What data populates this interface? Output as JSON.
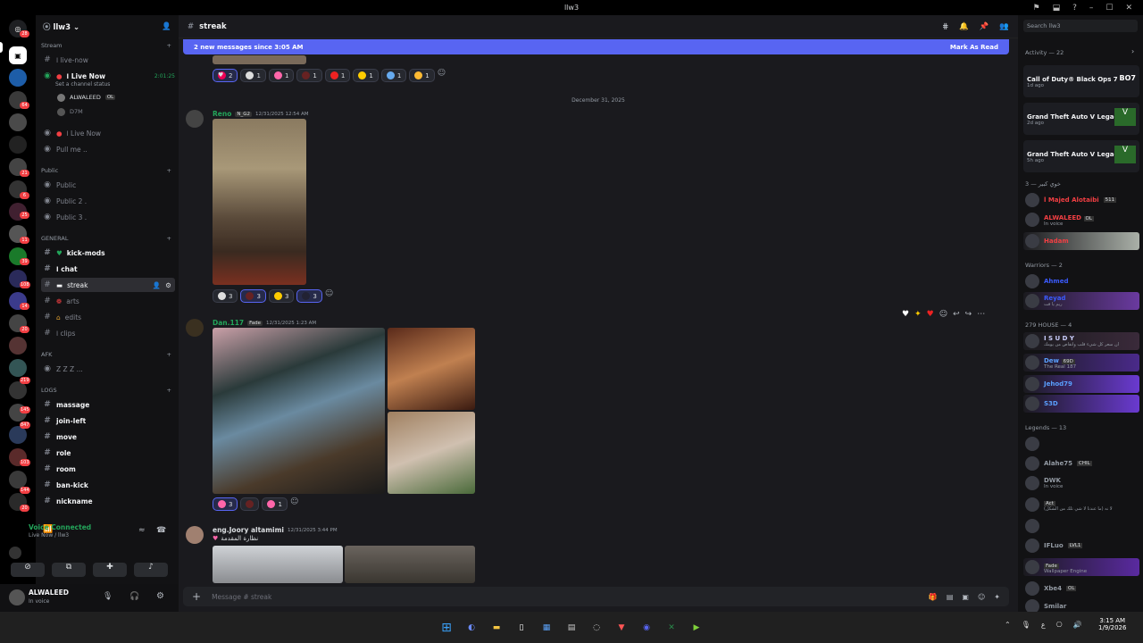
{
  "window": {
    "title": "llw3"
  },
  "server": {
    "name": "llw3"
  },
  "guild_badges": [
    "28",
    "64",
    "21",
    "6",
    "25",
    "11",
    "39",
    "108",
    "14",
    "20",
    "219",
    "145",
    "847",
    "103",
    "144",
    "20"
  ],
  "sidebar": {
    "categories": [
      {
        "name": "Stream"
      },
      {
        "name": "Public"
      },
      {
        "name": "GENERAL"
      },
      {
        "name": "AFK"
      },
      {
        "name": "LOGS"
      }
    ],
    "stream_channels": [
      {
        "label": "ا live-now"
      },
      {
        "label": "ا Live Now",
        "timer": "2:01:25",
        "status": "Set a channel status"
      },
      {
        "label": "ا Live Now"
      },
      {
        "label": "Pull me .."
      }
    ],
    "voice_users": [
      {
        "name": "ALWALEED",
        "badge": "OL"
      },
      {
        "name": "D7M"
      }
    ],
    "public_channels": [
      "Public",
      "Public 2 .",
      "Public 3 ."
    ],
    "general_channels": [
      "kick-mods",
      "ا chat",
      "streak",
      "arts",
      "edits",
      "ا clips"
    ],
    "afk_channels": [
      "Z Z Z  ..."
    ],
    "logs_channels": [
      "massage",
      "join-left",
      "move",
      "role",
      "room",
      "ban-kick",
      "nickname"
    ]
  },
  "voice": {
    "status": "Voice Connected",
    "channel": "Live Now / llw3"
  },
  "user": {
    "name": "ALWALEED",
    "status": "In voice"
  },
  "channel": {
    "name": "streak",
    "composer_placeholder": "Message # streak"
  },
  "new_messages": {
    "text": "2 new messages since 3:05 AM",
    "action": "Mark As Read"
  },
  "date_divider": "December 31, 2025",
  "messages": [
    {
      "author": "Reno",
      "tag": "N_G2",
      "time": "12/31/2025 12:54 AM",
      "reactions": [
        "3",
        "3",
        "3",
        "3"
      ]
    },
    {
      "author": "Dan.117",
      "tag": "Fade",
      "time": "12/31/2025 1:23 AM",
      "reactions": [
        "3",
        "1"
      ]
    },
    {
      "author": "eng.Joory altamimi",
      "time": "12/31/2025 3:44 PM",
      "text": "نظارة المقدمة"
    }
  ],
  "top_reactions": [
    "2",
    "1",
    "1",
    "1",
    "1",
    "1",
    "1",
    "1"
  ],
  "members": {
    "activity": {
      "header": "Activity — 22",
      "items": [
        {
          "game": "Call of Duty® Black Ops 7",
          "time": "1d ago",
          "badge": "BO7"
        },
        {
          "game": "Grand Theft Auto V Legacy",
          "time": "2d ago",
          "badge": "V"
        },
        {
          "game": "Grand Theft Auto V Legacy",
          "time": "5h ago",
          "badge": "V"
        }
      ]
    },
    "groups": [
      {
        "header": "خوي كبير — 3",
        "items": [
          {
            "name": "l Majed Alotaibi",
            "tag": "511",
            "color": "#f23f43"
          },
          {
            "name": "ALWALEED",
            "sub": "In voice",
            "tag": "OL",
            "color": "#f23f43"
          },
          {
            "name": "Hadam",
            "color": "#f23f43"
          }
        ]
      },
      {
        "header": "Warriors — 2",
        "items": [
          {
            "name": "Ahmed",
            "color": "#3b5bff"
          },
          {
            "name": "Reyad",
            "sub": "ريم يا فت",
            "color": "#3b5bff"
          }
        ]
      },
      {
        "header": "279 HOUSE — 4",
        "items": [
          {
            "name": "I S U D Y",
            "sub": "ان سعر كل شيء قلب وانقاص من يومك",
            "color": "#c9cdfb"
          },
          {
            "name": "Dew",
            "tag": "69D",
            "sub": "The Real 187",
            "color": "#5aa0ff"
          },
          {
            "name": "Jehod79",
            "color": "#5aa0ff"
          },
          {
            "name": "S3D",
            "color": "#5aa0ff"
          }
        ]
      },
      {
        "header": "Legends — 13",
        "items": [
          {
            "name": "",
            "color": "#949ba4"
          },
          {
            "name": "Alahe75",
            "tag": "CHIL",
            "color": "#949ba4"
          },
          {
            "name": "DWK",
            "sub": "In voice",
            "color": "#949ba4"
          },
          {
            "name": "",
            "tag": "Act",
            "sub": "لا نه (ما عندنا لا شي تلك من الشكل)",
            "color": "#949ba4"
          },
          {
            "name": "",
            "color": "#949ba4"
          },
          {
            "name": "IFLuo",
            "tag": "LVL1",
            "color": "#949ba4"
          },
          {
            "name": "",
            "tag": "Fade",
            "sub": "Wallpaper Engine",
            "color": "#949ba4"
          },
          {
            "name": "Xbe4",
            "tag": "OL",
            "color": "#949ba4"
          },
          {
            "name": "Smilar",
            "color": "#949ba4"
          }
        ]
      }
    ]
  },
  "search": {
    "placeholder": "Search llw3"
  },
  "clock": {
    "time": "3:15 AM",
    "date": "1/9/2026"
  },
  "tray": {
    "lang": "ع"
  }
}
